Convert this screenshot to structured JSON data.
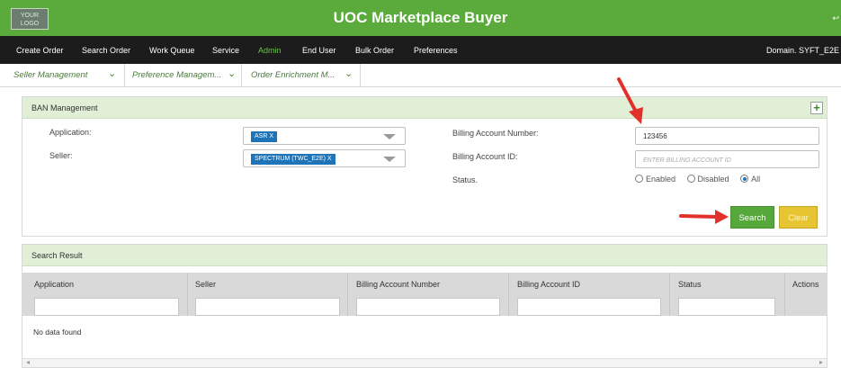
{
  "header": {
    "logo_text": "YOUR LOGO",
    "title": "UOC Marketplace Buyer",
    "logout_icon": "logout-icon"
  },
  "nav": {
    "items": [
      "Create Order",
      "Search Order",
      "Work Queue",
      "Service",
      "Admin",
      "End User",
      "Bulk Order",
      "Preferences"
    ],
    "active": "Admin",
    "domain": "Domain. SYFT_E2E"
  },
  "subnav": {
    "tabs": [
      "Seller Management",
      "Preference Managem...",
      "Order Enrichment M..."
    ]
  },
  "ban": {
    "title": "BAN Management",
    "application_label": "Application:",
    "application_value": "ASR X",
    "seller_label": "Seller:",
    "seller_value": "SPECTRUM (TWC_E2E) X",
    "ban_label": "Billing Account Number:",
    "ban_value": "123456",
    "baid_label": "Billing Account ID:",
    "baid_placeholder": "ENTER BILLING ACCOUNT ID",
    "status_label": "Status.",
    "status_options": [
      "Enabled",
      "Disabled",
      "All"
    ],
    "status_selected": "All",
    "search_label": "Search",
    "clear_label": "Clear"
  },
  "results": {
    "title": "Search Result",
    "columns": [
      "Application",
      "Seller",
      "Billing Account Number",
      "Billing Account ID",
      "Status",
      "Actions"
    ],
    "empty_text": "No data found"
  },
  "colors": {
    "brand_green": "#5aaa3c",
    "nav_bg": "#1c1c1c",
    "panel_header": "#e0efd5",
    "chip_blue": "#1f73b7",
    "clear_yellow": "#e7c432",
    "annotation_red": "#e2312b"
  }
}
